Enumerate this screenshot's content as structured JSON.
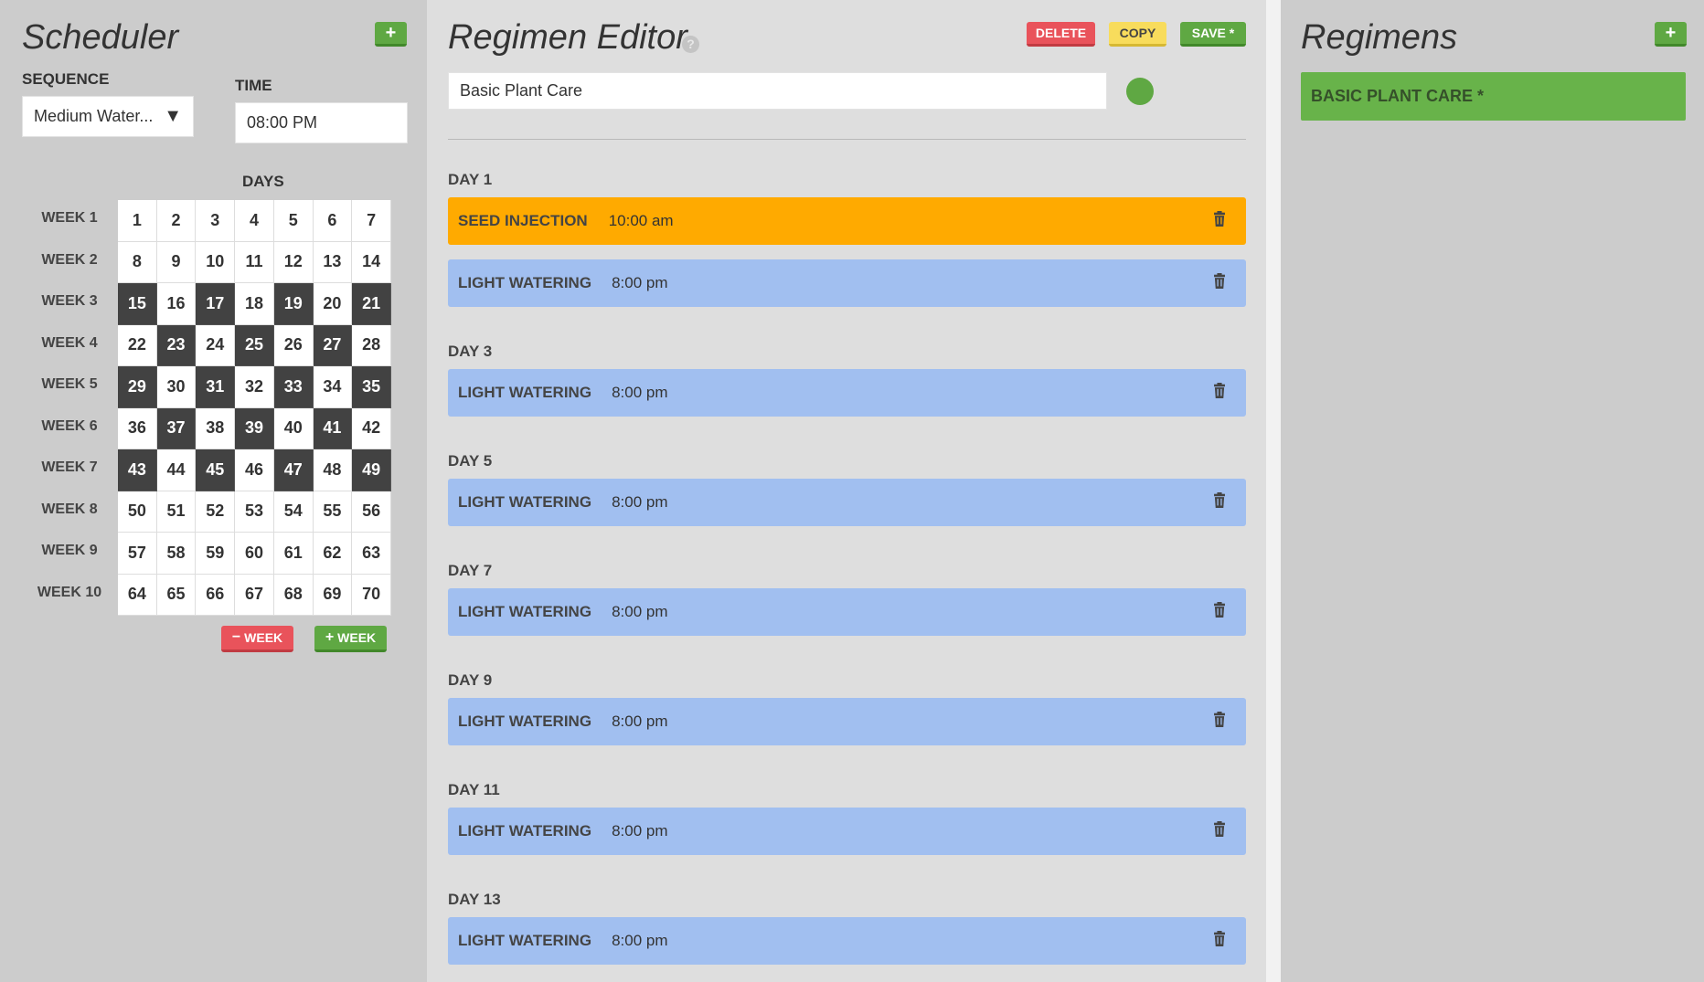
{
  "scheduler": {
    "title": "Scheduler",
    "add_label": "+",
    "sequence_label": "SEQUENCE",
    "sequence_value": "Medium Water...",
    "time_label": "TIME",
    "time_value": "08:00 PM",
    "days_label": "DAYS",
    "weeks": [
      "WEEK 1",
      "WEEK 2",
      "WEEK 3",
      "WEEK 4",
      "WEEK 5",
      "WEEK 6",
      "WEEK 7",
      "WEEK 8",
      "WEEK 9",
      "WEEK 10"
    ],
    "days": [
      1,
      2,
      3,
      4,
      5,
      6,
      7,
      8,
      9,
      10,
      11,
      12,
      13,
      14,
      15,
      16,
      17,
      18,
      19,
      20,
      21,
      22,
      23,
      24,
      25,
      26,
      27,
      28,
      29,
      30,
      31,
      32,
      33,
      34,
      35,
      36,
      37,
      38,
      39,
      40,
      41,
      42,
      43,
      44,
      45,
      46,
      47,
      48,
      49,
      50,
      51,
      52,
      53,
      54,
      55,
      56,
      57,
      58,
      59,
      60,
      61,
      62,
      63,
      64,
      65,
      66,
      67,
      68,
      69,
      70
    ],
    "selected_days": [
      15,
      17,
      19,
      21,
      23,
      25,
      27,
      29,
      31,
      33,
      35,
      37,
      39,
      41,
      43,
      45,
      47,
      49
    ],
    "minus_week_label": "WEEK",
    "plus_week_label": "WEEK"
  },
  "editor": {
    "title": "Regimen Editor",
    "delete_label": "DELETE",
    "copy_label": "COPY",
    "save_label": "SAVE *",
    "name_value": "Basic Plant Care",
    "color": "#5fa843",
    "days": [
      {
        "label": "DAY 1",
        "items": [
          {
            "name": "SEED INJECTION",
            "time": "10:00 am",
            "color": "orange"
          },
          {
            "name": "LIGHT WATERING",
            "time": "8:00 pm",
            "color": "blue"
          }
        ]
      },
      {
        "label": "DAY 3",
        "items": [
          {
            "name": "LIGHT WATERING",
            "time": "8:00 pm",
            "color": "blue"
          }
        ]
      },
      {
        "label": "DAY 5",
        "items": [
          {
            "name": "LIGHT WATERING",
            "time": "8:00 pm",
            "color": "blue"
          }
        ]
      },
      {
        "label": "DAY 7",
        "items": [
          {
            "name": "LIGHT WATERING",
            "time": "8:00 pm",
            "color": "blue"
          }
        ]
      },
      {
        "label": "DAY 9",
        "items": [
          {
            "name": "LIGHT WATERING",
            "time": "8:00 pm",
            "color": "blue"
          }
        ]
      },
      {
        "label": "DAY 11",
        "items": [
          {
            "name": "LIGHT WATERING",
            "time": "8:00 pm",
            "color": "blue"
          }
        ]
      },
      {
        "label": "DAY 13",
        "items": [
          {
            "name": "LIGHT WATERING",
            "time": "8:00 pm",
            "color": "blue"
          }
        ]
      }
    ]
  },
  "regimens": {
    "title": "Regimens",
    "add_label": "+",
    "items": [
      "BASIC PLANT CARE *"
    ]
  }
}
